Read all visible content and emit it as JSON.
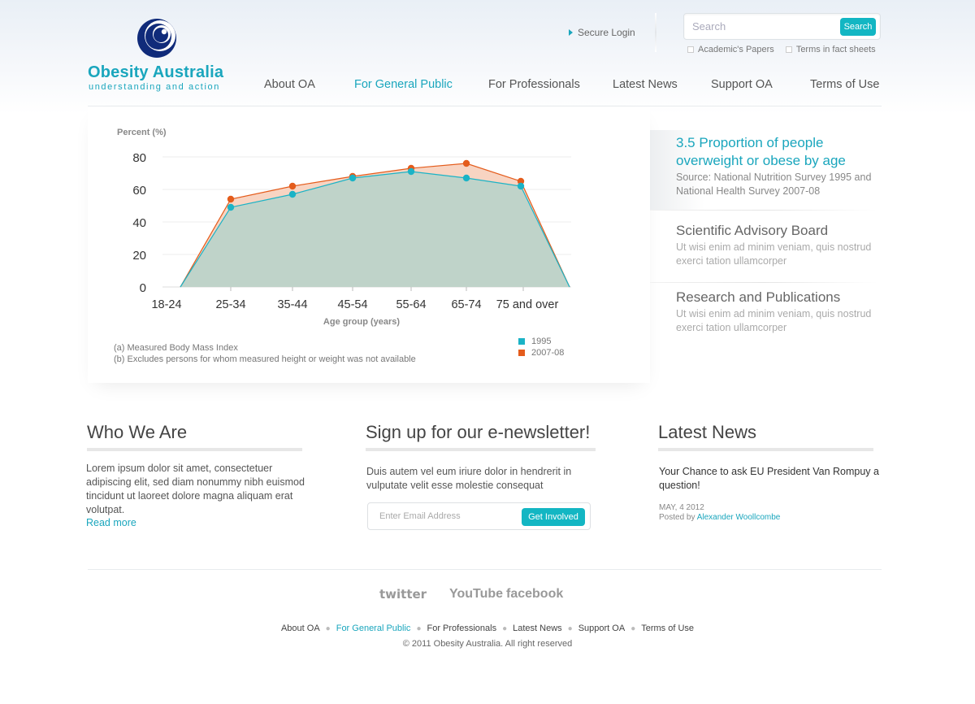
{
  "brand": {
    "name": "Obesity Australia",
    "tagline": "understanding and action",
    "color": "#1aa6bd"
  },
  "header": {
    "secure_login": "Secure Login",
    "search_placeholder": "Search",
    "search_button": "Search",
    "search_options": [
      "Academic's Papers",
      "Terms in fact sheets"
    ]
  },
  "nav": {
    "items": [
      "About OA",
      "For General Public",
      "For Professionals",
      "Latest News",
      "Support OA",
      "Terms of Use"
    ],
    "active": "For General Public"
  },
  "chart_data": {
    "type": "area",
    "ylabel": "Percent (%)",
    "xlabel": "Age group (years)",
    "ylim": [
      0,
      80
    ],
    "yticks": [
      0,
      20,
      40,
      60,
      80
    ],
    "categories": [
      "18-24",
      "25-34",
      "35-44",
      "45-54",
      "55-64",
      "65-74",
      "75 and over"
    ],
    "series": [
      {
        "name": "1995",
        "color": "#1bb3c6",
        "values": [
          49,
          57,
          67,
          71,
          67,
          62
        ]
      },
      {
        "name": "2007-08",
        "color": "#e45c1c",
        "values": [
          54,
          62,
          68,
          73,
          76,
          65
        ]
      }
    ],
    "grid": true,
    "legend": "bottom-right",
    "notes": [
      "(a) Measured Body Mass Index",
      "(b) Excludes persons for whom measured height or weight was not available"
    ]
  },
  "sidebar": {
    "items": [
      {
        "title": "3.5 Proportion of people overweight or obese by age",
        "desc": "Source: National Nutrition Survey 1995 and National Health Survey 2007-08",
        "active": true
      },
      {
        "title": "Scientific Advisory Board",
        "desc": "Ut wisi enim ad minim veniam, quis nostrud exerci tation ullamcorper",
        "active": false
      },
      {
        "title": "Research and Publications",
        "desc": "Ut wisi enim ad minim veniam, quis nostrud exerci tation ullamcorper",
        "active": false
      }
    ]
  },
  "who": {
    "title": "Who We Are",
    "text": "Lorem ipsum dolor sit amet, consectetuer adipiscing elit, sed diam nonummy nibh euismod tincidunt ut laoreet dolore magna aliquam erat volutpat.",
    "read_more": "Read more"
  },
  "newsletter": {
    "title": "Sign up for our e-newsletter!",
    "text": "Duis autem vel eum iriure dolor in hendrerit in vulputate velit esse molestie consequat",
    "placeholder": "Enter Email Address",
    "button": "Get Involved"
  },
  "latest": {
    "title": "Latest News",
    "headline": "Your Chance to ask EU President Van Rompuy a question!",
    "date": "MAY, 4 2012",
    "posted_by_label": "Posted by",
    "author": "Alexander Woollcombe"
  },
  "footer": {
    "social": [
      "twitter",
      "YouTube",
      "facebook"
    ],
    "nav": [
      "About OA",
      "For General Public",
      "For Professionals",
      "Latest News",
      "Support OA",
      "Terms of Use"
    ],
    "copyright": "© 2011 Obesity Australia. All right reserved"
  }
}
